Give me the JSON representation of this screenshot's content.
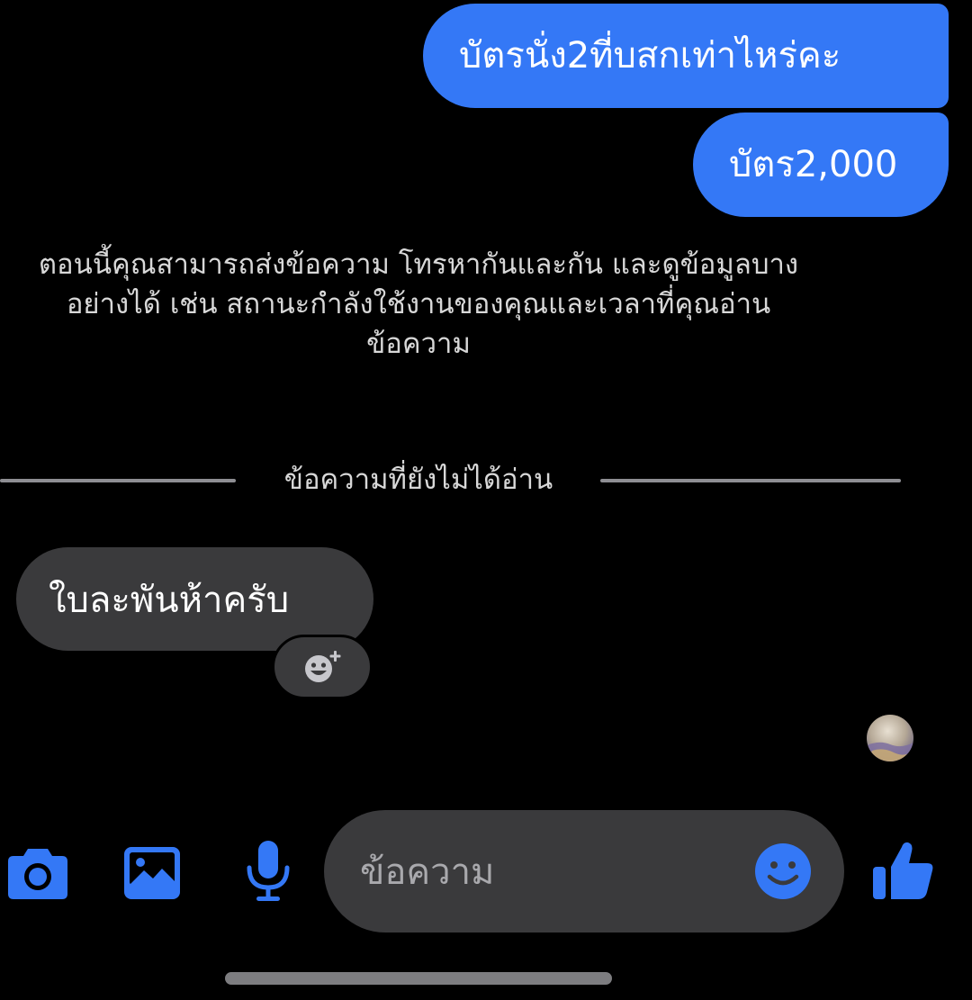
{
  "messages": {
    "outgoing": [
      {
        "text": "บัตรนั่ง2ที่บสกเท่าไหร่คะ"
      },
      {
        "text": "บัตร2,000"
      }
    ],
    "system_notice": "ตอนนี้คุณสามารถส่งข้อความ โทรหากันและกัน และดูข้อมูลบางอย่างได้ เช่น สถานะกำลังใช้งานของคุณและเวลาที่คุณอ่านข้อความ",
    "unread_divider_label": "ข้อความที่ยังไม่ได้อ่าน",
    "incoming": [
      {
        "text": "ใบละพันห้าครับ"
      }
    ]
  },
  "composer": {
    "placeholder": "ข้อความ",
    "icons": [
      "camera-icon",
      "image-icon",
      "microphone-icon",
      "emoji-icon",
      "thumbs-up-icon"
    ]
  },
  "colors": {
    "background": "#000000",
    "accent": "#3478f6",
    "bubble_incoming": "#3a3a3c",
    "secondary_text": "#d8d8d8"
  }
}
